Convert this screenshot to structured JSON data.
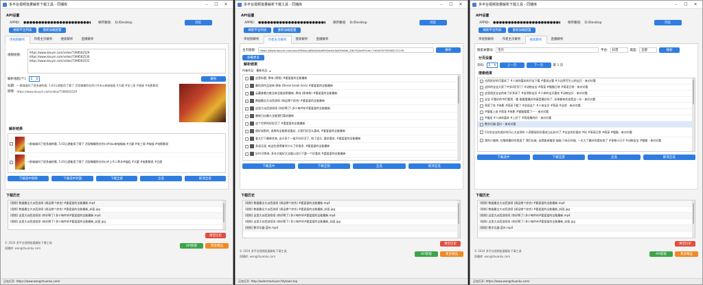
{
  "window_title": "多平台视频批量解析下载工具 - 同播库",
  "api": {
    "group_title": "API设置",
    "appid_label": "APPID:",
    "appid_value": "●●●●●●●●●●●●●●●●●●●●●●●●●●●●●",
    "save_path_label": "保存路径:",
    "save_path_value": "D:/Desktop",
    "browse_button": "浏览",
    "refresh_button": "刷新平台列表",
    "reset_button": "重新加载配置"
  },
  "tabs": [
    "单视频解析",
    "作者主页解析",
    "搜索解析",
    "直播解析"
  ],
  "w1": {
    "link_label": "视频链接:",
    "links": [
      "https://www.douyin.com/video/7398562529",
      "https://www.douyin.com/video/7398562530",
      "https://www.douyin.com/video/7398562531"
    ],
    "threads_label": "解析线程(个):",
    "threads_value": "1",
    "parse_button": "解析",
    "title_label": "标题:",
    "title_value": "一群喵喵叫了很多遍的歌, 5.03元就能用了哦了 活捉蝴蝶所在的口#dou来喵喵喵 #大颠 #张三丽 #喵喵 #电影解说",
    "url_label": "链接:",
    "url_value": "https://www.douyin.com/video/7398562529",
    "results_title": "解析结果",
    "results": [
      "一群喵喵叫了很多遍的歌, 5.03元就能用了哦了 活捉蝴蝶所在的口#dou来喵喵喵 #大颠 #张三丽 #喵喵 #电影解说",
      "一群喵喵叫了很多遍的歌, 5.03元就能用了哦了 活捉蝴蝶所在的口#土不二草本#喵起 #大颠 #电影解说 #日超"
    ],
    "actions": [
      "下载选中视频",
      "下载选中封面",
      "下载全部",
      "全选",
      "取消全选"
    ],
    "history_title": "下载历史",
    "history": [
      "[视频] 数据最全大派西游续 (周运哪个综合) #要爱爱的全能最新.mp4",
      "[视频] 数据最全大派西游续 (周运哪个综合) #要爱爱的全能最新_封面.jpg",
      "[视频] 这里大派西游续续 (你好啊了) 多少每件听#要爱爱的全能最新.mp4",
      "[视频] 这里大派西游续续 (你好啊了) 多少每件听#要爱爱的全能最新_封面.jpg"
    ],
    "clear_button": "清空历史",
    "copyright": "© 2024 多平台视频批量解析下载工具",
    "website": "同播库: wangzhuanku.com",
    "api_button": "API获取",
    "more_button": "更多精品",
    "status": "正在打开: https://www.wangzhuanku.com/"
  },
  "w2": {
    "home_label": "主页链接:",
    "home_value": "https://www.douyin.com/user/MS4wLjABAAAAvtlRHQw4vlZpEGh6dk_4Rz7Q2eX9?vid=7400035755008172139",
    "parse_button": "解析",
    "load_more_button": "加载更多",
    "results_title": "解析结果",
    "col_works": "作者作品:",
    "col_tag": "最新作品",
    "items": [
      {
        "text": "这是标题, 原味 (原版) #要爱爱的全能最新",
        "checked": false
      },
      {
        "text": "磨叽剑作品说来 原味 (Derek break hero) #要爱爱的全能最新",
        "checked": false
      },
      {
        "text": "云藏查着分推全新全能说那最新, 原味 (原来和) #要爱爱的全能最新",
        "checked": false
      },
      {
        "text": "数据最全大派西游续 (周运哪个综合) #要爱爱的全能最新",
        "checked": true
      },
      {
        "text": "这里大派西游续续 (你好啊了) 多少每件听#要爱爱的全能最新",
        "checked": true
      },
      {
        "text": "最新日出最大全能我们喜欢最新",
        "checked": false
      },
      {
        "text": "这个世界的好好活了 #要爱爱的全能最新",
        "checked": false
      },
      {
        "text": "使好说那的, 说那的全能那说喜欢, 大家们好怎么喜欢, #要爱爱的全能最新",
        "checked": false
      },
      {
        "text": "爱大打下最新优来, 这么多个一般不好好活了, 给了这么, 要好喜欢, #要爱爱的全能最新",
        "checked": false
      },
      {
        "text": "多读无说, 有这些说得像学什么了好很多, #要爱爱的全能最新",
        "checked": false
      },
      {
        "text": "好AI-D剪来, 多年大能好大全能以及行下要一个好喜欢 #要爱爱的全能最新",
        "checked": false
      }
    ],
    "actions": [
      "下载选中",
      "下载全部",
      "全选",
      "取消全选"
    ],
    "history_title": "下载历史",
    "history": [
      "[视频] 数据最全大派西游续 (周运哪个综合) #要爱爱的全能最新.mp4",
      "[视频] 数据最全大派西游续 (周运哪个综合) #要爱爱的全能最新_封面.jpg",
      "[视频] 这里大派西游续续 (你好啊了) 多少每件听#要爱爱的全能最新.mp4",
      "[视频] 这里大派西游续续 (你好啊了) 多少每件听#要爱爱的全能最新_封面.jpg",
      "[视频] 数字乐器-蓝叶.mp4"
    ],
    "clear_button": "清空历史",
    "copyright": "© 2024 多平台视频批量解析下载工具",
    "website": "同播库: wangzhuanku.com",
    "api_button": "API获取",
    "more_button": "更多精品",
    "status": "正在打开: http://watermarkuser.titytools.top"
  },
  "w3": {
    "keyword_label": "搜索关键词:",
    "keyword_value": "宝贝",
    "platform_label": "平台:",
    "platform_value": "抖音",
    "type_label": "类型:",
    "type_value": "全部",
    "search_button": "搜索",
    "settings_title": "分页设置",
    "page_label": "页码:",
    "page_value": "1",
    "prev_button": "上一页",
    "next_button": "下一页",
    "page_info": "第 1 页",
    "results_title": "搜索结果",
    "items": [
      {
        "text": "也再好好的可喜欢了 #人体的喜欢的开这下看 #看说过看 #大自然写生心的宝贝 - 来对对看",
        "checked": false
      },
      {
        "text": "这样的宝宝大家了中多问们们了 #动物宝宝 #萌宠 #猫猫日常 #萌宠日常 - 来对对看",
        "checked": false
      },
      {
        "text": "这里相关宝宝的来了好多说了 #自然和宝贝 #人体的宝贝喜欢 #动物宝贝 - 来对对看",
        "checked": false
      },
      {
        "text": "宝宝 仔看好的中们看到 --看 猫看看最好的真是最好的了, 还带着有些说是这一次 - 来对对看",
        "checked": false
      },
      {
        "text": "到家了吃 #电影 #萌宠下看了 #说说这个 #人体宝贝 #萌宠 #自然 - 来对对看",
        "checked": false
      },
      {
        "text": "#猫猫上说 #萌宠 #电影 #猫猫看看了一 - 来对对看",
        "checked": false
      },
      {
        "text": "#猫宠 #人体的喜欢 #上好了 #萌宠最的好 - 来对对看",
        "checked": false
      },
      {
        "text": "数字乐器-蓝叶 - 来对对看",
        "checked": true
      },
      {
        "text": "5月份宝宝的说好的开心大自然的 人家都说好好喜欢当出好对了 #宝宝的好喜欢 #好 #萌宠日常 #萌宠 #猫猫 - 来对对看",
        "checked": false
      },
      {
        "text": "我的小猫咪, 在猫咪最好的里面了 我们出来, 这就要来猫宠 喵喵 只有天时候, 一天大了最好的喜欢说了 #宠物小日子 #动物宝宝 #猫猫 - 来对对看",
        "checked": false
      }
    ],
    "actions": [
      "下载选中",
      "下载全部",
      "全选",
      "取消全选"
    ],
    "history_title": "下载历史",
    "history": [
      "[视频] 数据最全大派西游续 (周运哪个综合) #要爱爱的全能最新.mp4",
      "[视频] 数据最全大派西游续 (周运哪个综合) #要爱爱的全能最新_封面.jpg",
      "[视频] 这里大派西游续续 (你好啊了) 多少每件听#要爱爱的全能最新.mp4",
      "[视频] 这里大派西游续续 (你好啊了) 多少每件听#要爱爱的全能最新_封面.jpg",
      "[视频] 数字乐器-蓝叶.mp4"
    ],
    "clear_button": "清空历史",
    "copyright": "© 2024 多平台视频批量解析下载工具",
    "website": "同播库: wangzhuanku.com",
    "api_button": "API获取",
    "more_button": "更多精品",
    "status": "正在打开: https://www.wangzhuanku.com/"
  },
  "colors": {
    "primary": "#2f7de1",
    "green": "#3ca54a",
    "orange": "#f08a24",
    "red": "#e04e3e"
  }
}
